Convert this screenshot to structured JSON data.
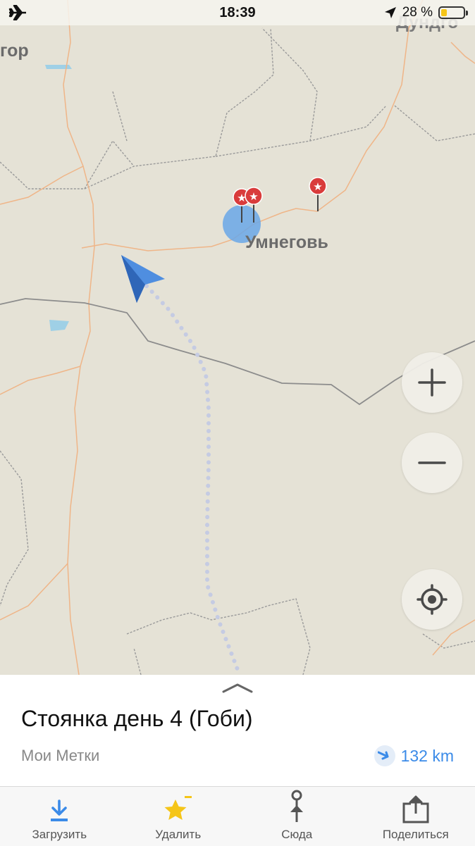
{
  "status_bar": {
    "mode_icon": "airplane-icon",
    "time": "18:39",
    "location_icon": "location-arrow-icon",
    "battery_percent": "28 %",
    "battery_level": 0.28,
    "battery_color": "#f5c518"
  },
  "map": {
    "labels": {
      "umnegov": "Умнеговь",
      "gor": "гор",
      "dundgo": "Дундго"
    },
    "marker_color": "#d93b3b",
    "accuracy_color": "#6aa7e8",
    "arrow_color": "#3f7fd9",
    "route_color": "#c5cbe3",
    "controls": {
      "zoom_in_icon": "plus-icon",
      "zoom_out_icon": "minus-icon",
      "locate_icon": "crosshair-icon"
    }
  },
  "place_panel": {
    "title": "Стоянка день 4 (Гоби)",
    "subtitle": "Мои Метки",
    "distance": "132 km",
    "distance_icon": "direction-arrow-icon",
    "accent": "#3b8be8"
  },
  "tabbar": {
    "items": [
      {
        "label": "Загрузить",
        "icon": "download-icon"
      },
      {
        "label": "Удалить",
        "icon": "star-remove-icon"
      },
      {
        "label": "Сюда",
        "icon": "pin-route-icon"
      },
      {
        "label": "Поделиться",
        "icon": "share-icon"
      }
    ]
  }
}
